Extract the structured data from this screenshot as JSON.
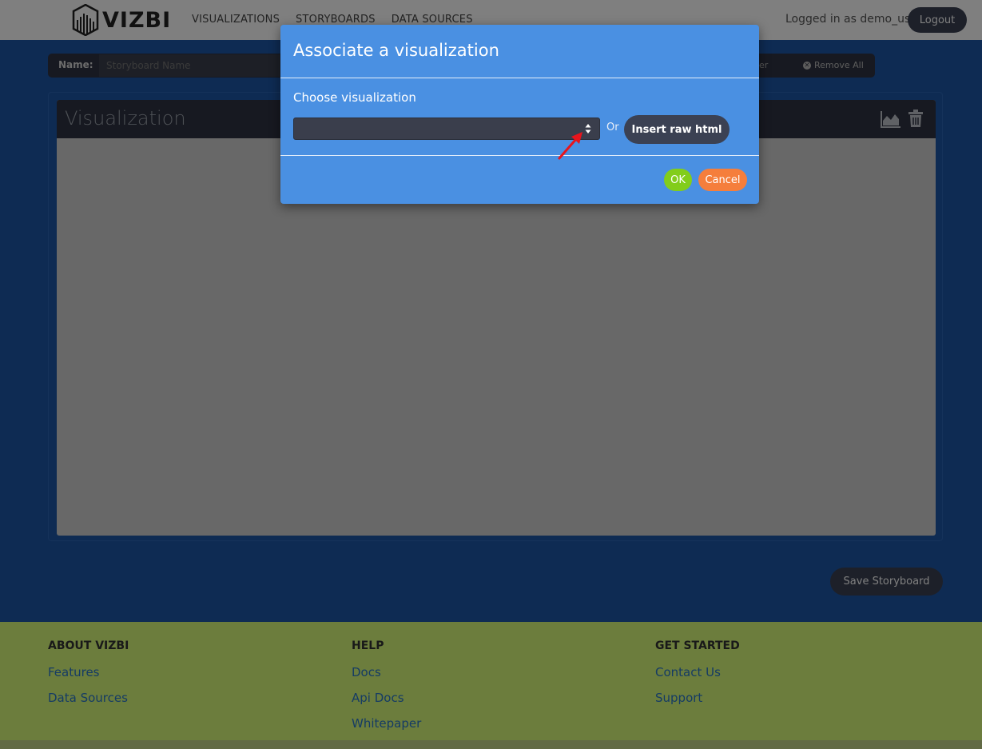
{
  "navbar": {
    "logo_text": "VIZBI",
    "links": [
      {
        "label": "VISUALIZATIONS"
      },
      {
        "label": "STORYBOARDS"
      },
      {
        "label": "DATA SOURCES"
      }
    ],
    "logged_in_text": "Logged in as demo_user",
    "logout_label": "Logout"
  },
  "toolbar": {
    "name_label": "Name:",
    "name_placeholder": "Storyboard Name",
    "add_container_label": "iner",
    "remove_all_label": "Remove All"
  },
  "workspace": {
    "panel_title": "Visualization"
  },
  "save_button_label": "Save Storyboard",
  "footer": {
    "columns": [
      {
        "heading": "ABOUT VIZBI",
        "links": [
          "Features",
          "Data Sources"
        ]
      },
      {
        "heading": "HELP",
        "links": [
          "Docs",
          "Api Docs",
          "Whitepaper"
        ]
      },
      {
        "heading": "GET STARTED",
        "links": [
          "Contact Us",
          "Support"
        ]
      }
    ]
  },
  "modal": {
    "title": "Associate a visualization",
    "choose_label": "Choose visualization",
    "select_value": "",
    "or_text": "Or",
    "raw_html_label": "Insert raw html",
    "ok_label": "OK",
    "cancel_label": "Cancel"
  },
  "colors": {
    "brand_blue": "#4a90e2",
    "dark_button": "#3b4153",
    "ok_green": "#82cd1b",
    "cancel_orange": "#f57e3c",
    "footer_lime": "#d8fb7a",
    "annotation_red": "#e8141c"
  }
}
